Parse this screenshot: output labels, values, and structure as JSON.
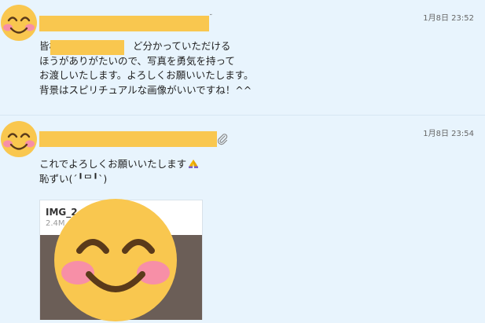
{
  "messages": [
    {
      "time": "1月8日 23:52",
      "lines": [
        "皆様",
        "ほうがありがたいので、写真を勇気を持って",
        "お渡しいたします。よろしくお願いいたします。",
        "背景はスピリチュアルな画像がいいですね！^^"
      ],
      "line1_suffix": "ど分かっていただける"
    },
    {
      "time": "1月8日 23:54",
      "lines": [
        "これでよろしくお願いいたします",
        "恥ずい(´╹ᄆ╹`)"
      ],
      "attachment": {
        "file_name": "IMG_2",
        "file_size": "2.4M"
      }
    }
  ],
  "icons": {
    "avatar": "smiling-face-emoji",
    "attachment": "paperclip-icon",
    "pray": "folded-hands-emoji"
  },
  "colors": {
    "background": "#e8f4fd",
    "redaction": "#f9c74f",
    "emoji_face": "#f9c74f",
    "emoji_cheek": "#f78fa7"
  }
}
